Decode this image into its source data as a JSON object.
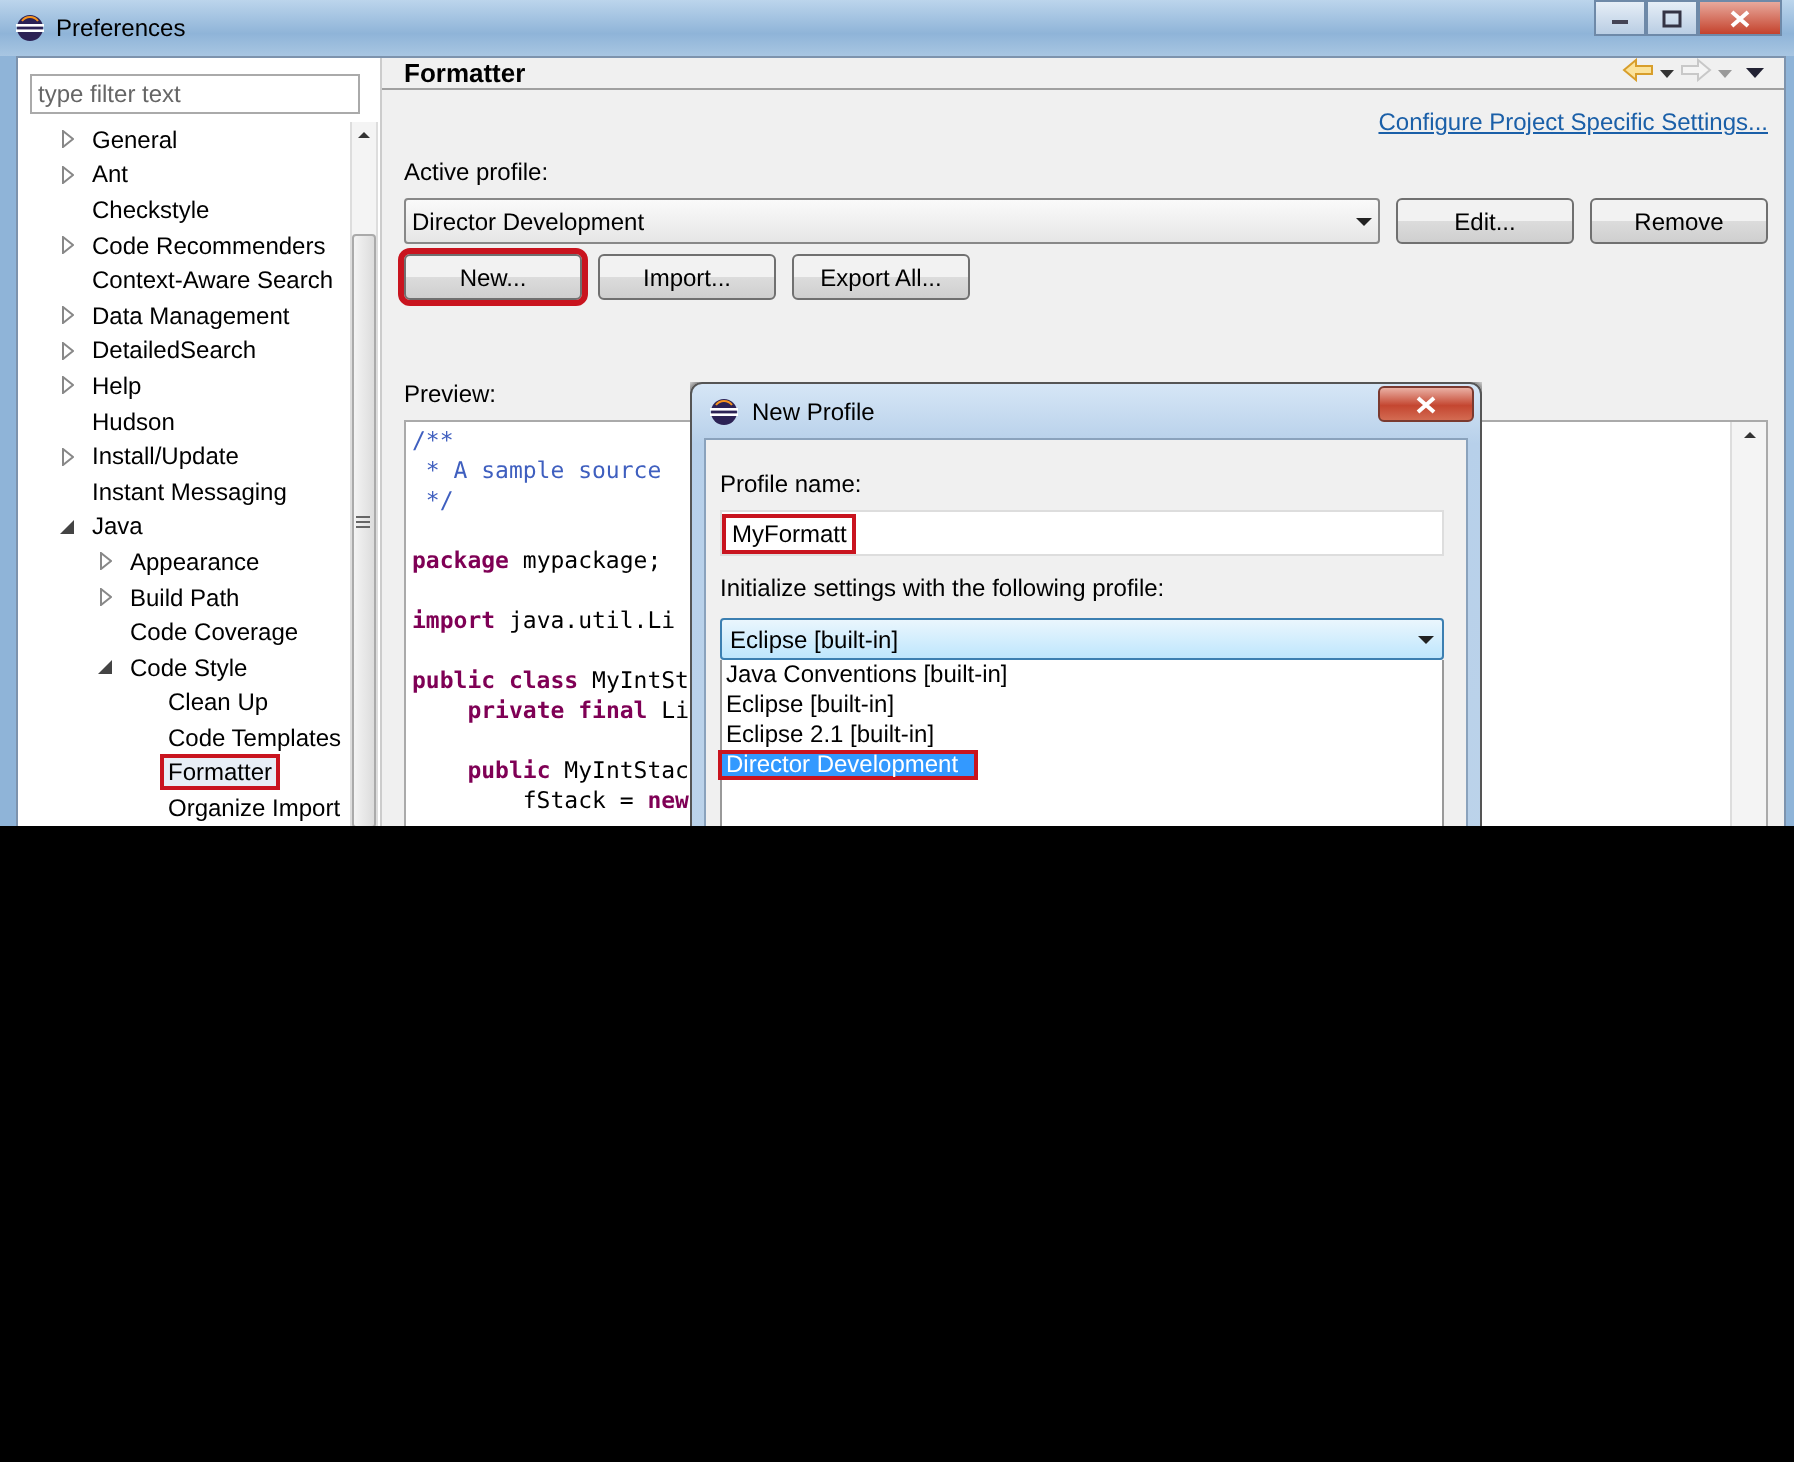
{
  "window": {
    "title": "Preferences"
  },
  "filter": {
    "placeholder": "type filter text"
  },
  "tree": [
    {
      "label": "General",
      "expanded": false,
      "selected": false,
      "annotated": false
    },
    {
      "label": "Ant",
      "expanded": false,
      "selected": false,
      "annotated": false
    },
    {
      "label": "Checkstyle",
      "selected": false,
      "annotated": false
    },
    {
      "label": "Code Recommenders",
      "expanded": false,
      "selected": false,
      "annotated": false
    },
    {
      "label": "Context-Aware Search",
      "selected": false,
      "annotated": false
    },
    {
      "label": "Data Management",
      "expanded": false,
      "selected": false,
      "annotated": false
    },
    {
      "label": "DetailedSearch",
      "expanded": false,
      "selected": false,
      "annotated": false
    },
    {
      "label": "Help",
      "expanded": false,
      "selected": false,
      "annotated": false
    },
    {
      "label": "Hudson",
      "selected": false,
      "annotated": false
    },
    {
      "label": "Install/Update",
      "expanded": false,
      "selected": false,
      "annotated": false
    },
    {
      "label": "Instant Messaging",
      "selected": false,
      "annotated": false
    },
    {
      "label": "Java",
      "expanded": true,
      "selected": false,
      "annotated": false,
      "children": [
        {
          "label": "Appearance",
          "expanded": false,
          "selected": false,
          "annotated": false
        },
        {
          "label": "Build Path",
          "expanded": false,
          "selected": false,
          "annotated": false
        },
        {
          "label": "Code Coverage",
          "selected": false,
          "annotated": false
        },
        {
          "label": "Code Style",
          "expanded": true,
          "selected": false,
          "annotated": false,
          "children": [
            {
              "label": "Clean Up",
              "selected": false,
              "annotated": false
            },
            {
              "label": "Code Templates",
              "selected": false,
              "annotated": false
            },
            {
              "label": "Formatter",
              "selected": true,
              "annotated": true
            },
            {
              "label": "Organize Import",
              "selected": false,
              "annotated": false
            }
          ]
        }
      ]
    }
  ],
  "page": {
    "title": "Formatter",
    "back_enabled": true,
    "forward_enabled": false,
    "link": "Configure Project Specific Settings...",
    "active_profile_label": "Active profile:",
    "active_profile": "Director Development",
    "side_buttons": [
      {
        "label": "Edit...",
        "annotated": false
      },
      {
        "label": "Remove",
        "annotated": false
      }
    ],
    "buttons": [
      {
        "label": "New...",
        "annotated": true
      },
      {
        "label": "Import...",
        "annotated": false
      },
      {
        "label": "Export All...",
        "annotated": false
      }
    ],
    "preview_label": "Preview:",
    "code": [
      {
        "kind": "comment",
        "text": "/**"
      },
      {
        "kind": "comment",
        "text": " * A sample source"
      },
      {
        "kind": "comment",
        "text": " */"
      },
      {
        "kind": "blank"
      },
      {
        "kind": "code",
        "text": "**package** mypackage;"
      },
      {
        "kind": "blank"
      },
      {
        "kind": "code",
        "text": "**import** java.util.Li"
      },
      {
        "kind": "blank"
      },
      {
        "kind": "code",
        "text": "**public class** MyIntSt"
      },
      {
        "kind": "code",
        "text": "    **private final** Li"
      },
      {
        "kind": "blank"
      },
      {
        "kind": "code",
        "text": "    **public** MyIntStac"
      },
      {
        "kind": "code",
        "text": "        fStack = **new**"
      }
    ]
  },
  "dialog": {
    "title": "New Profile",
    "name_label": "Profile name:",
    "name_value": "MyFormatt",
    "name_annotated": true,
    "init_label": "Initialize settings with the following profile:",
    "init_value": "Eclipse [built-in]",
    "options": [
      {
        "label": "Java Conventions [built-in]",
        "selected": false,
        "annotated": false
      },
      {
        "label": "Eclipse [built-in]",
        "selected": false,
        "annotated": false
      },
      {
        "label": "Eclipse 2.1 [built-in]",
        "selected": false,
        "annotated": false
      },
      {
        "label": "Director Development",
        "selected": true,
        "annotated": true
      }
    ]
  }
}
